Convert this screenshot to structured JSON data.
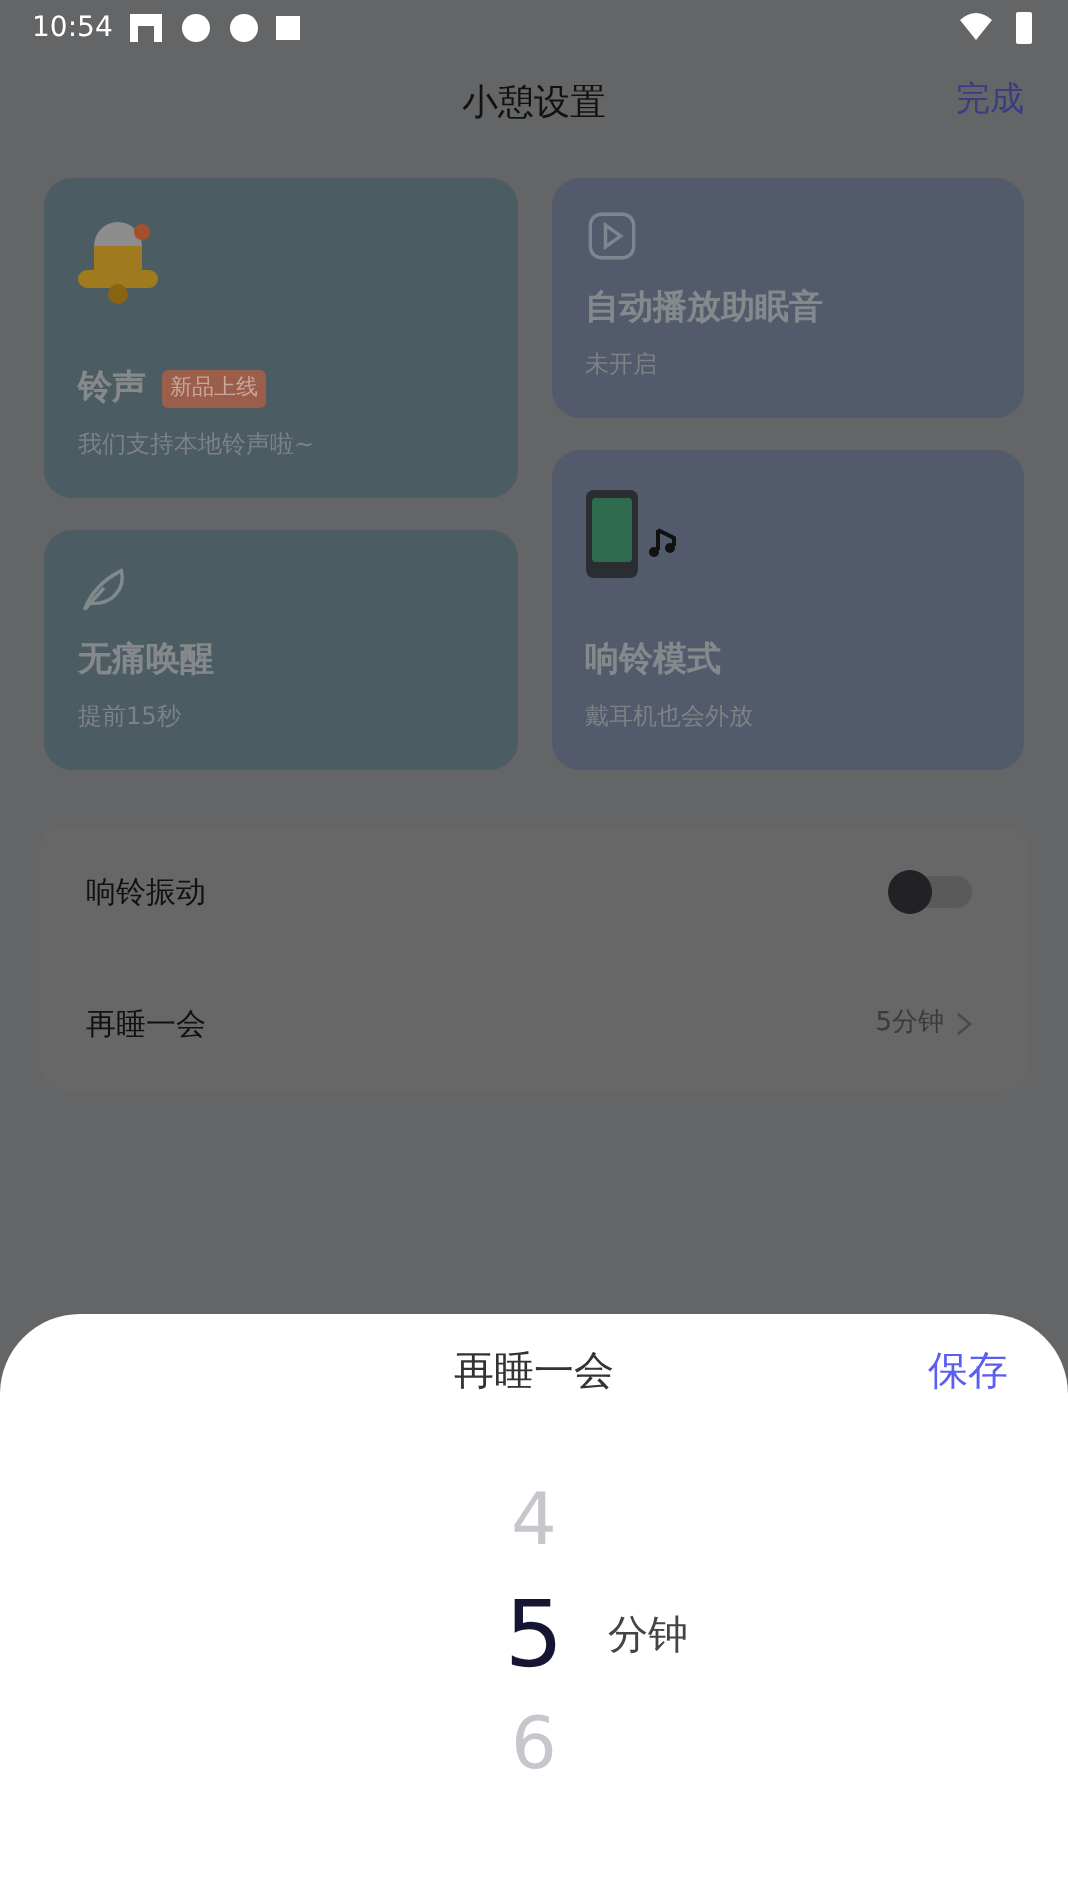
{
  "status_bar": {
    "time": "10:54"
  },
  "header": {
    "title": "小憩设置",
    "done": "完成"
  },
  "cards": [
    {
      "kind": "bell",
      "title": "铃声",
      "badge": "新品上线",
      "subtitle": "我们支持本地铃声啦~"
    },
    {
      "kind": "leaf",
      "title": "无痛唤醒",
      "subtitle": "提前15秒"
    },
    {
      "kind": "play",
      "title": "自动播放助眠音",
      "subtitle": "未开启"
    },
    {
      "kind": "phone",
      "title": "响铃模式",
      "subtitle": "戴耳机也会外放"
    }
  ],
  "settings": [
    {
      "kind": "toggle",
      "label": "响铃振动",
      "on": false
    },
    {
      "kind": "value",
      "label": "再睡一会",
      "value": "5分钟"
    }
  ],
  "sheet": {
    "title": "再睡一会",
    "save": "保存",
    "unit": "分钟",
    "options": [
      {
        "label": "4",
        "selected": false
      },
      {
        "label": "5",
        "selected": true
      },
      {
        "label": "6",
        "selected": false
      }
    ]
  }
}
